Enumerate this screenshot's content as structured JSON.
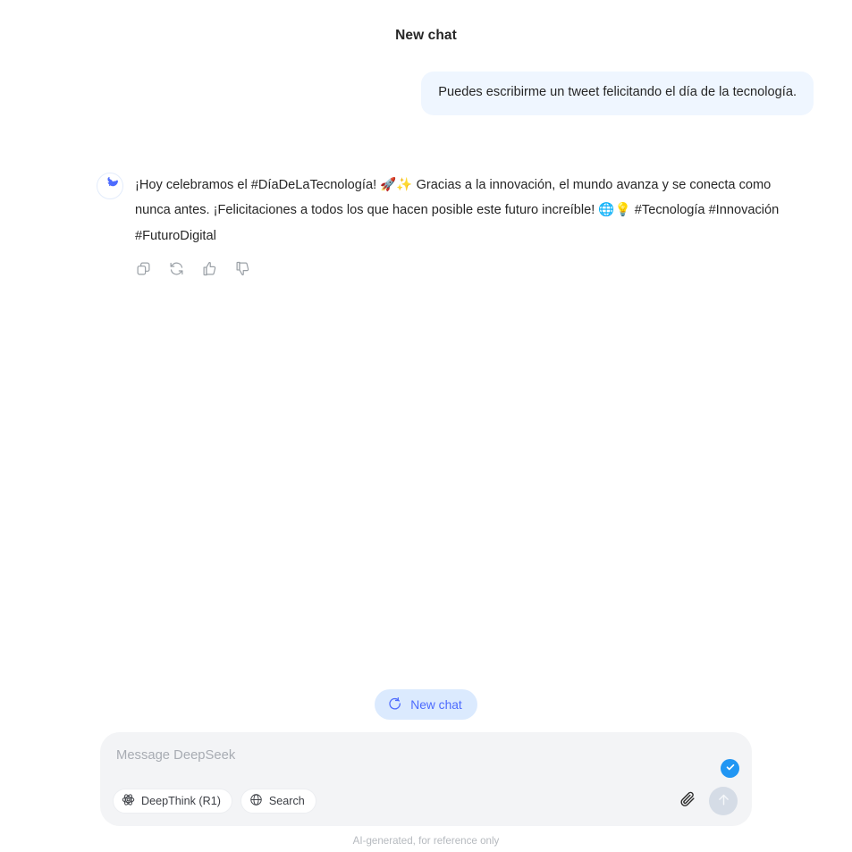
{
  "header": {
    "title": "New chat"
  },
  "conversation": {
    "user_message": {
      "text": "Puedes escribirme un tweet felicitando el día de la tecnología."
    },
    "assistant_message": {
      "avatar_icon": "deepseek-whale-logo",
      "text_part1": "¡Hoy celebramos el #DíaDeLaTecnología! ",
      "emoji1": "🚀",
      "emoji2": "✨",
      "text_part2": " Gracias a la innovación, el mundo avanza y se conecta como nunca antes. ¡Felicitaciones a todos los que hacen posible este futuro increíble! ",
      "emoji3": "🌐",
      "emoji4": "💡",
      "text_part3": " #Tecnología #Innovación #FuturoDigital",
      "actions": [
        {
          "name": "copy",
          "icon": "copy-icon"
        },
        {
          "name": "regenerate",
          "icon": "refresh-icon"
        },
        {
          "name": "like",
          "icon": "thumbs-up-icon"
        },
        {
          "name": "dislike",
          "icon": "thumbs-down-icon"
        }
      ]
    }
  },
  "new_chat_button": {
    "label": "New chat",
    "icon": "new-chat-icon"
  },
  "composer": {
    "placeholder": "Message DeepSeek",
    "value": "",
    "tools": [
      {
        "label": "DeepThink (R1)",
        "icon": "atom-icon"
      },
      {
        "label": "Search",
        "icon": "globe-icon"
      }
    ],
    "attach_icon": "paperclip-icon",
    "send_icon": "arrow-up-icon",
    "status_badge_icon": "check-icon"
  },
  "footer": {
    "note": "AI-generated, for reference only"
  },
  "colors": {
    "brand": "#4d6bfe",
    "user_bubble": "#eff6ff",
    "composer_bg": "#f3f4f6",
    "badge_blue": "#2196f3",
    "newchat_bg": "#dbeafe"
  }
}
